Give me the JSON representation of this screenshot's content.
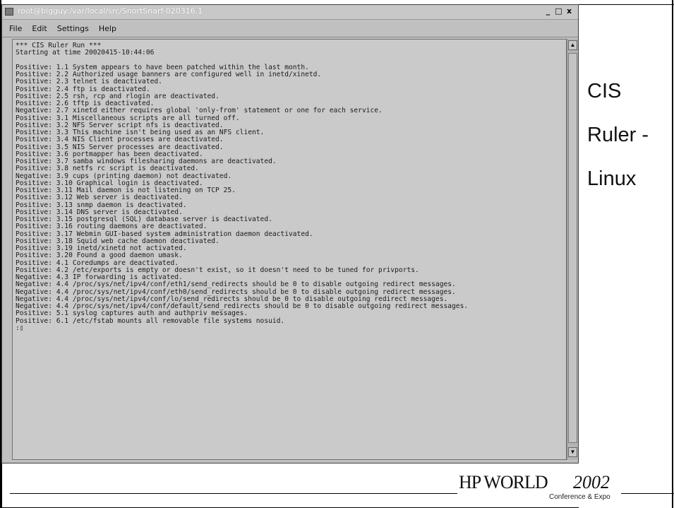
{
  "window": {
    "title": "root@bigguy:/var/local/src/SnortSnarf-020316.1",
    "controls": [
      "_",
      "□",
      "x"
    ]
  },
  "menu": [
    "File",
    "Edit",
    "Settings",
    "Help"
  ],
  "terminal": {
    "lines": [
      "*** CIS Ruler Run ***",
      "Starting at time 20020415-10:44:06",
      "",
      "Positive: 1.1 System appears to have been patched within the last month.",
      "Positive: 2.2 Authorized usage banners are configured well in inetd/xinetd.",
      "Positive: 2.3 telnet is deactivated.",
      "Positive: 2.4 ftp is deactivated.",
      "Positive: 2.5 rsh, rcp and rlogin are deactivated.",
      "Positive: 2.6 tftp is deactivated.",
      "Negative: 2.7 xinetd either requires global 'only-from' statement or one for each service.",
      "Positive: 3.1 Miscellaneous scripts are all turned off.",
      "Positive: 3.2 NFS Server script nfs is deactivated.",
      "Positive: 3.3 This machine isn't being used as an NFS client.",
      "Positive: 3.4 NIS Client processes are deactivated.",
      "Positive: 3.5 NIS Server processes are deactivated.",
      "Positive: 3.6 portmapper has been deactivated.",
      "Positive: 3.7 samba windows filesharing daemons are deactivated.",
      "Positive: 3.8 netfs rc script is deactivated.",
      "Negative: 3.9 cups (printing daemon) not deactivated.",
      "Positive: 3.10 Graphical login is deactivated.",
      "Positive: 3.11 Mail daemon is not listening on TCP 25.",
      "Positive: 3.12 Web server is deactivated.",
      "Positive: 3.13 snmp daemon is deactivated.",
      "Positive: 3.14 DNS server is deactivated.",
      "Positive: 3.15 postgresql (SQL) database server is deactivated.",
      "Positive: 3.16 routing daemons are deactivated.",
      "Positive: 3.17 Webmin GUI-based system administration daemon deactivated.",
      "Positive: 3.18 Squid web cache daemon deactivated.",
      "Positive: 3.19 inetd/xinetd not activated.",
      "Positive: 3.20 Found a good daemon umask.",
      "Positive: 4.1 Coredumps are deactivated.",
      "Positive: 4.2 /etc/exports is empty or doesn't exist, so it doesn't need to be tuned for privports.",
      "Negative: 4.3 IP forwarding is activated.",
      "Negative: 4.4 /proc/sys/net/ipv4/conf/eth1/send_redirects should be 0 to disable outgoing redirect messages.",
      "Negative: 4.4 /proc/sys/net/ipv4/conf/eth0/send_redirects should be 0 to disable outgoing redirect messages.",
      "Negative: 4.4 /proc/sys/net/ipv4/conf/lo/send_redirects should be 0 to disable outgoing redirect messages.",
      "Negative: 4.4 /proc/sys/net/ipv4/conf/default/send_redirects should be 0 to disable outgoing redirect messages.",
      "Positive: 5.1 syslog captures auth and authpriv messages.",
      "Positive: 6.1 /etc/fstab mounts all removable file systems nosuid.",
      ":▯"
    ]
  },
  "scrollbar": {
    "up_arrow": "▲",
    "down_arrow": "▼"
  },
  "side_title": {
    "line1": "CIS",
    "line2": "Ruler -",
    "line3": "Linux"
  },
  "logo": {
    "brand": "HP WORLD",
    "year": "2002",
    "subtitle": "Conference & Expo"
  }
}
